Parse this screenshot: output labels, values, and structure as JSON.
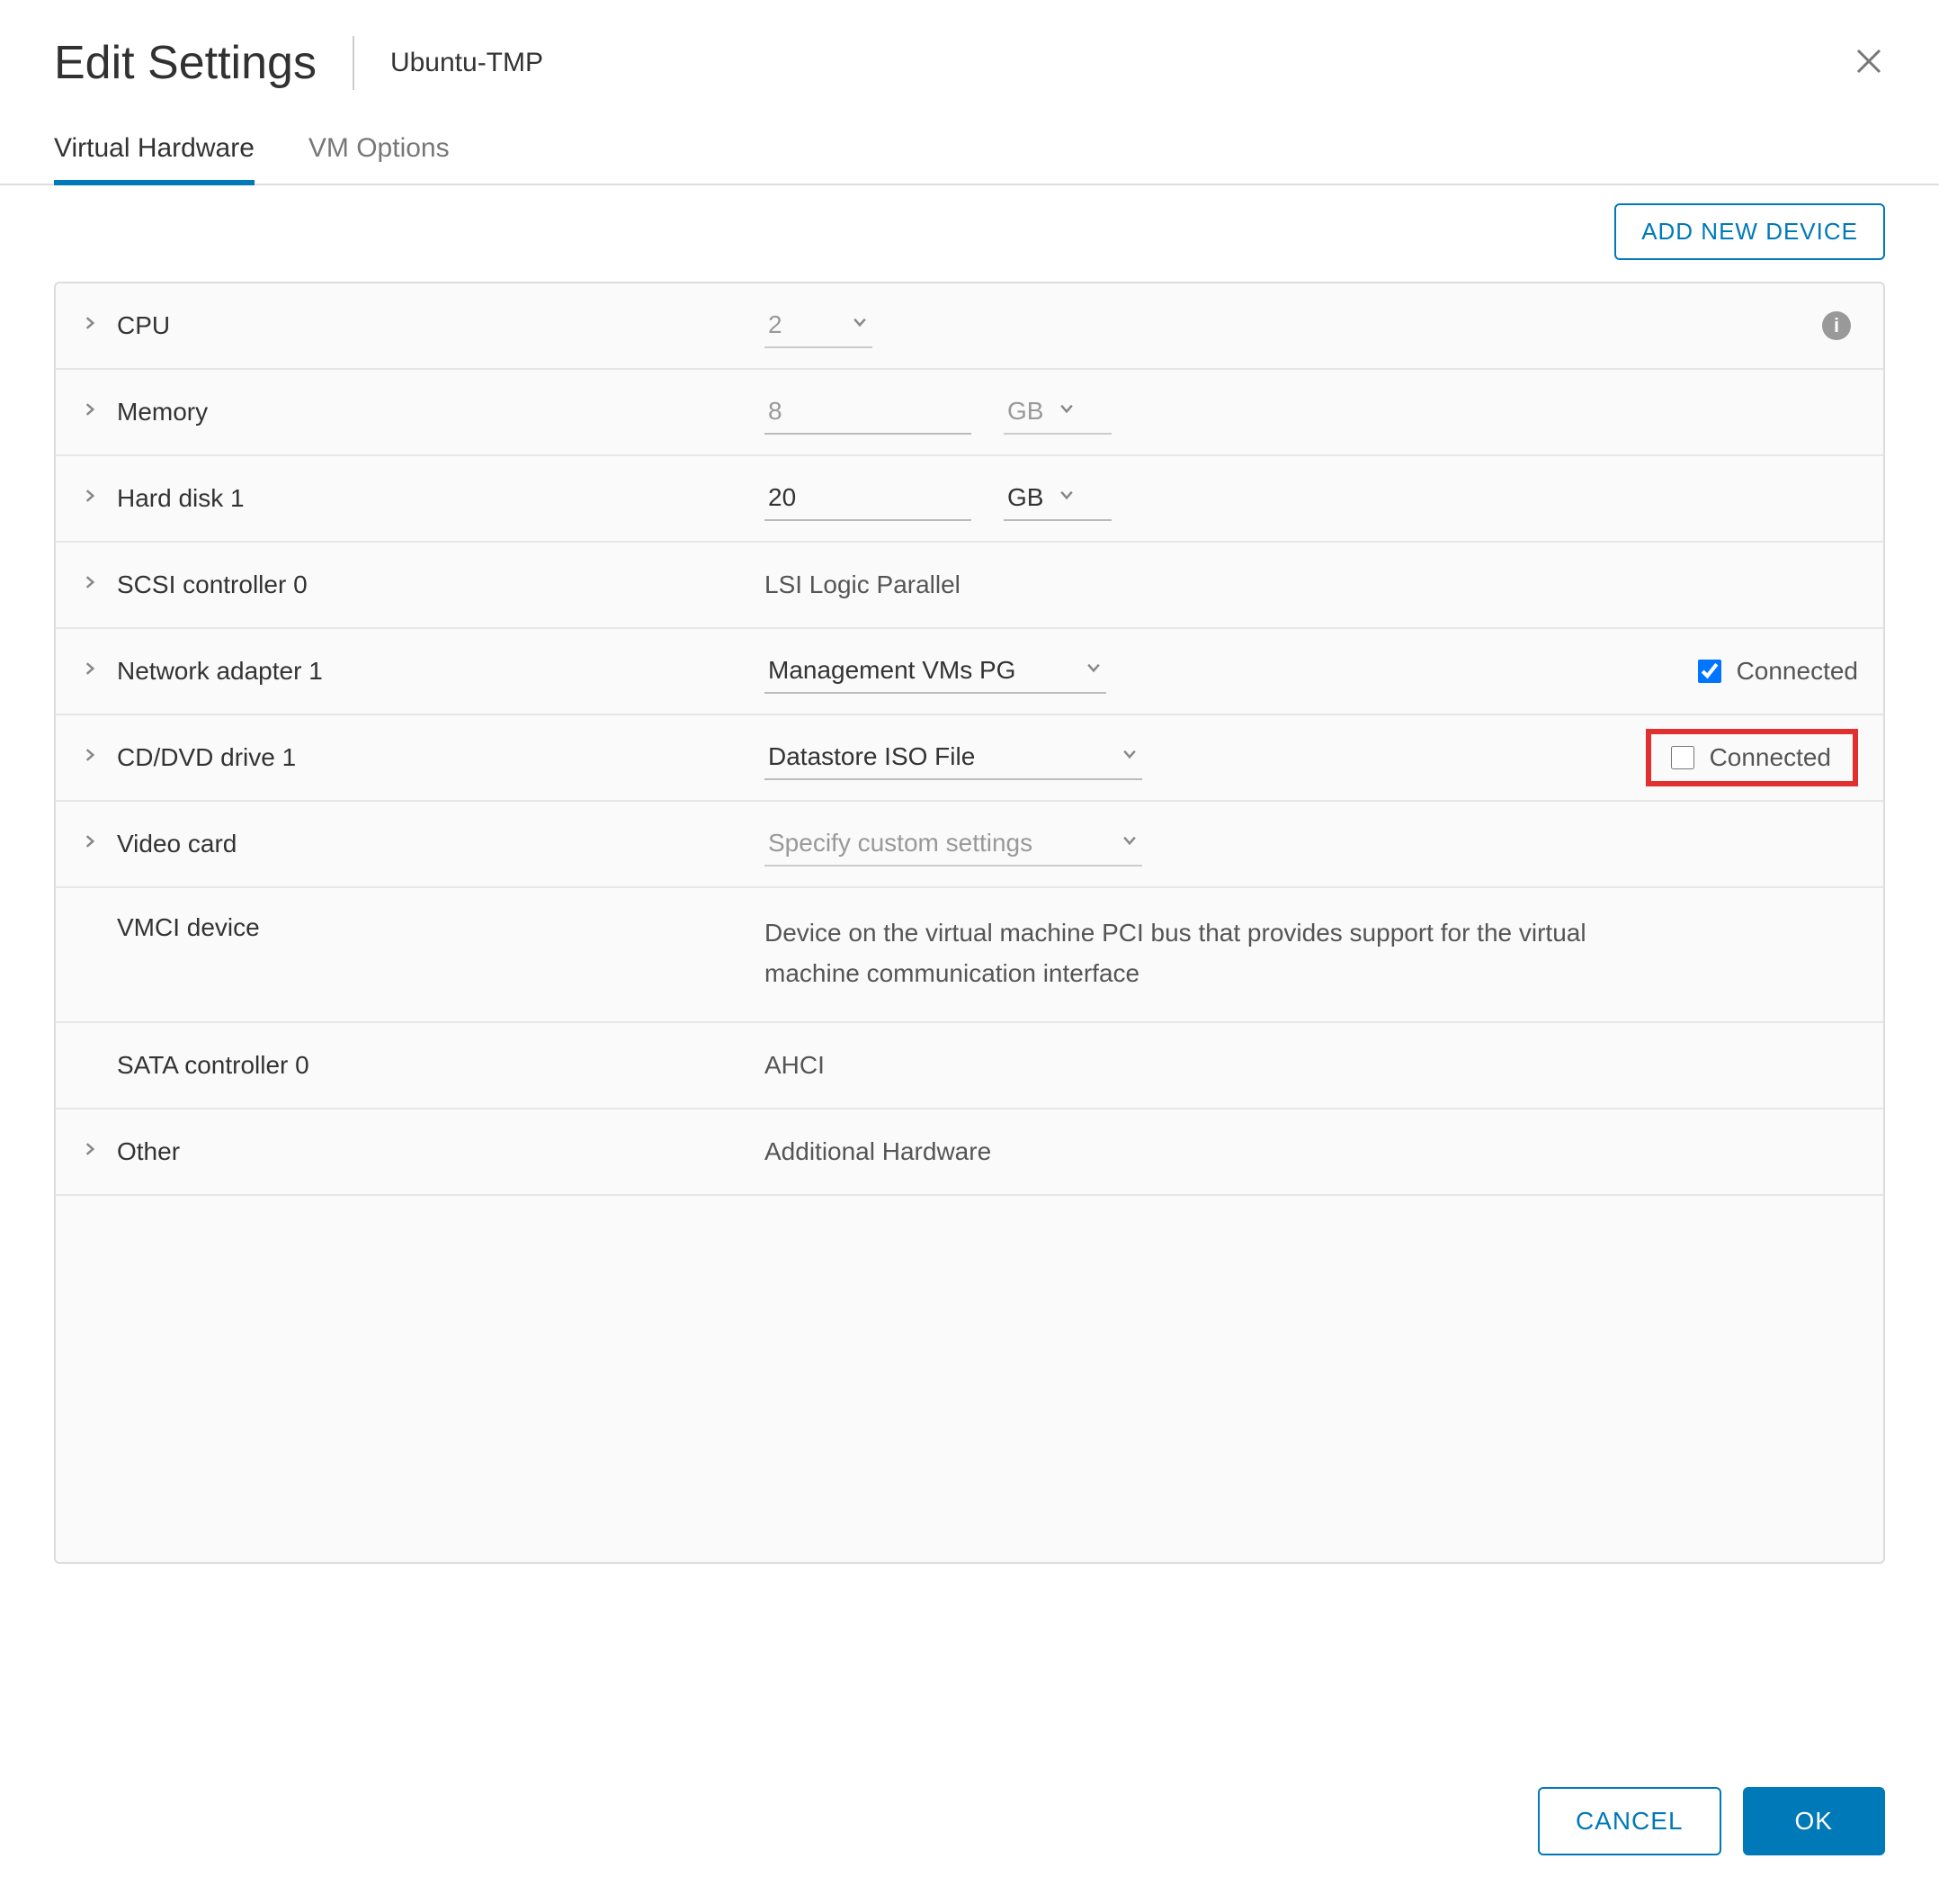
{
  "header": {
    "title": "Edit Settings",
    "subtitle": "Ubuntu-TMP"
  },
  "tabs": {
    "virtual_hardware": "Virtual Hardware",
    "vm_options": "VM Options"
  },
  "toolbar": {
    "add_device": "ADD NEW DEVICE"
  },
  "rows": {
    "cpu": {
      "label": "CPU",
      "value": "2"
    },
    "memory": {
      "label": "Memory",
      "value": "8",
      "unit": "GB"
    },
    "hard_disk": {
      "label": "Hard disk 1",
      "value": "20",
      "unit": "GB"
    },
    "scsi": {
      "label": "SCSI controller 0",
      "value": "LSI Logic Parallel"
    },
    "network": {
      "label": "Network adapter 1",
      "value": "Management VMs PG",
      "connected_label": "Connected",
      "connected": true
    },
    "cd_dvd": {
      "label": "CD/DVD drive 1",
      "value": "Datastore ISO File",
      "connected_label": "Connected",
      "connected": false
    },
    "video": {
      "label": "Video card",
      "value": "Specify custom settings"
    },
    "vmci": {
      "label": "VMCI device",
      "value": "Device on the virtual machine PCI bus that provides support for the virtual machine communication interface"
    },
    "sata": {
      "label": "SATA controller 0",
      "value": "AHCI"
    },
    "other": {
      "label": "Other",
      "value": "Additional Hardware"
    }
  },
  "footer": {
    "cancel": "CANCEL",
    "ok": "OK"
  },
  "icons": {
    "info": "i"
  }
}
